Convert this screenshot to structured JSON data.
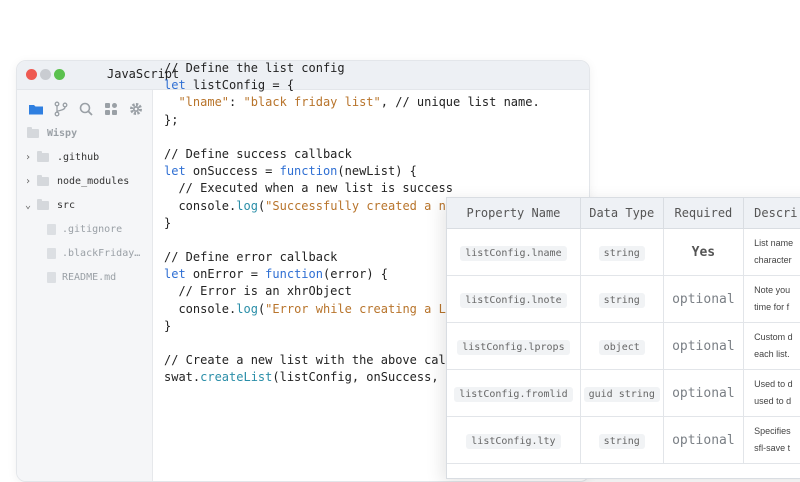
{
  "window": {
    "title": "JavaScript"
  },
  "sidebar": {
    "project": "Wispy",
    "tree": [
      {
        "label": ".github",
        "type": "folder",
        "expanded": false
      },
      {
        "label": "node_modules",
        "type": "folder",
        "expanded": false
      },
      {
        "label": "src",
        "type": "folder",
        "expanded": true
      },
      {
        "label": ".gitignore",
        "type": "file"
      },
      {
        "label": ".blackFriday…",
        "type": "file"
      },
      {
        "label": "README.md",
        "type": "file"
      }
    ],
    "icons": [
      "folder-icon",
      "branch-icon",
      "search-icon",
      "extensions-icon",
      "gear-icon"
    ]
  },
  "code": {
    "lines": [
      "// Define the list config",
      "let listConfig = {",
      "  \"lname\": \"black friday list\", // unique list name.",
      "};",
      "",
      "// Define success callback",
      "let onSuccess = function(newList) {",
      "  // Executed when a new list is success",
      "  console.log(\"Successfully created a ne",
      "}",
      "",
      "// Define error callback",
      "let onError = function(error) {",
      "  // Error is an xhrObject",
      "  console.log(\"Error while creating a Li",
      "}",
      "",
      "// Create a new list with the above call",
      "swat.createList(listConfig, onSuccess, o"
    ]
  },
  "table": {
    "headers": [
      "Property Name",
      "Data Type",
      "Required",
      "Descri"
    ],
    "rows": [
      {
        "name": "listConfig.lname",
        "type": "string",
        "required": "Yes",
        "desc": [
          "List name",
          "character"
        ]
      },
      {
        "name": "listConfig.lnote",
        "type": "string",
        "required": "optional",
        "desc": [
          "Note you",
          "time for f"
        ]
      },
      {
        "name": "listConfig.lprops",
        "type": "object",
        "required": "optional",
        "desc": [
          "Custom d",
          "each list."
        ]
      },
      {
        "name": "listConfig.fromlid",
        "type": "guid string",
        "required": "optional",
        "desc": [
          "Used to d",
          "used to d"
        ]
      },
      {
        "name": "listConfig.lty",
        "type": "string",
        "required": "optional",
        "desc": [
          "Specifies",
          "sfl-save t"
        ]
      }
    ]
  },
  "colors": {
    "keyword": "#2f6fd3",
    "string": "#b8742b",
    "function": "#2a8ea8"
  }
}
